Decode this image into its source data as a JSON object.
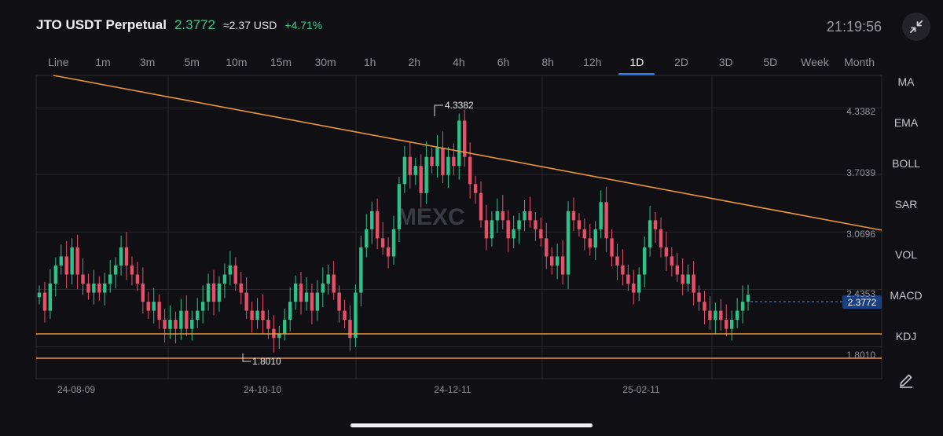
{
  "header": {
    "symbol": "JTO USDT Perpetual",
    "price": "2.3772",
    "usd_value": "≈2.37 USD",
    "change": "+4.71%",
    "time": "21:19:56"
  },
  "tabs": [
    "Line",
    "1m",
    "3m",
    "5m",
    "10m",
    "15m",
    "30m",
    "1h",
    "2h",
    "4h",
    "6h",
    "8h",
    "12h",
    "1D",
    "2D",
    "3D",
    "5D",
    "Week",
    "Month"
  ],
  "active_tab": "1D",
  "indicators": [
    "MA",
    "EMA",
    "BOLL",
    "SAR",
    "VOL",
    "MACD",
    "KDJ"
  ],
  "colors": {
    "up": "#2ec28a",
    "down": "#e8506a",
    "trendline": "#e8963c",
    "accent": "#2f7df6",
    "last_price": "#3b82f6"
  },
  "watermark": "MEXC",
  "chart_data": {
    "type": "candlestick",
    "y_ticks": [
      "4.3382",
      "3.7039",
      "3.0696",
      "2.4353",
      "1.8010"
    ],
    "x_ticks": [
      "24-08-09",
      "24-10-10",
      "24-12-11",
      "25-02-11"
    ],
    "ylim": [
      1.45,
      4.8
    ],
    "high_label": "4.3382",
    "low_label": "1.8010",
    "last_price": 2.3772,
    "last_price_label": "2.3772",
    "support_levels": [
      2.0,
      1.8
    ],
    "trendline": {
      "from": [
        "24-07-17",
        4.8
      ],
      "to": [
        "25-03-22",
        3.1
      ]
    },
    "candles_description": "daily candles 24-07-17 to 25-03-22; wicks omitted for brevity in values",
    "closes": [
      2.4,
      2.2,
      2.5,
      2.7,
      2.8,
      2.6,
      2.9,
      2.6,
      2.5,
      2.4,
      2.5,
      2.4,
      2.5,
      2.6,
      2.7,
      2.9,
      2.7,
      2.6,
      2.5,
      2.3,
      2.2,
      2.3,
      2.1,
      2.0,
      2.1,
      2.0,
      2.2,
      2.0,
      2.1,
      2.2,
      2.3,
      2.5,
      2.3,
      2.5,
      2.6,
      2.7,
      2.5,
      2.4,
      2.2,
      2.1,
      2.2,
      2.1,
      2.0,
      1.9,
      1.95,
      2.1,
      2.3,
      2.5,
      2.3,
      2.4,
      2.2,
      2.4,
      2.5,
      2.6,
      2.4,
      2.2,
      2.1,
      1.9,
      2.4,
      2.9,
      3.1,
      3.3,
      3.0,
      2.9,
      2.8,
      3.1,
      3.6,
      3.9,
      3.7,
      3.8,
      3.5,
      3.9,
      3.8,
      4.0,
      3.7,
      3.9,
      3.8,
      4.3,
      3.9,
      3.6,
      3.5,
      3.2,
      3.0,
      3.2,
      3.3,
      3.2,
      3.0,
      3.1,
      3.2,
      3.3,
      3.2,
      3.1,
      3.0,
      2.8,
      2.7,
      2.8,
      2.6,
      3.3,
      3.2,
      3.1,
      3.0,
      2.9,
      3.1,
      3.4,
      3.0,
      2.8,
      2.7,
      2.6,
      2.5,
      2.4,
      2.6,
      2.9,
      3.2,
      3.1,
      2.9,
      2.8,
      2.7,
      2.6,
      2.5,
      2.6,
      2.4,
      2.3,
      2.2,
      2.1,
      2.2,
      2.1,
      2.0,
      2.1,
      2.2,
      2.3,
      2.3772
    ]
  }
}
